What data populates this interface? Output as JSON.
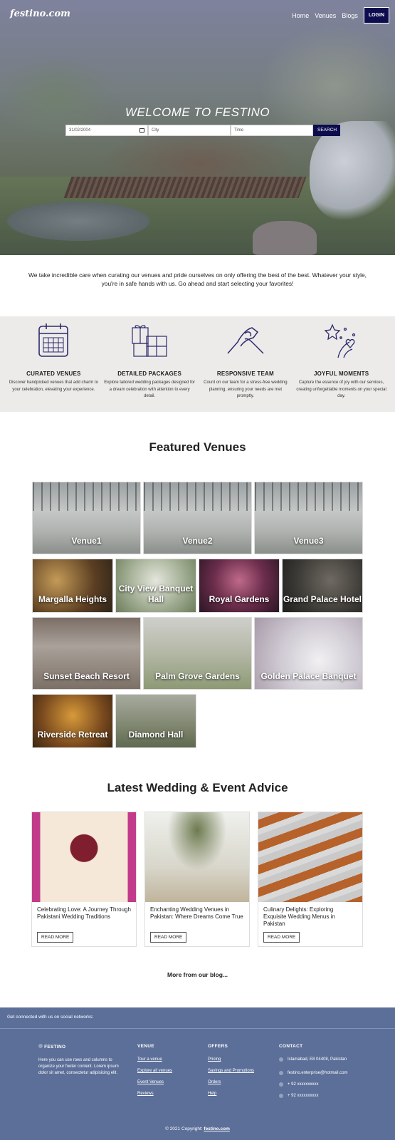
{
  "header": {
    "logo": "festino.com",
    "nav": [
      "Home",
      "Venues",
      "Blogs"
    ],
    "login_label": "LOGIN"
  },
  "hero": {
    "title": "WELCOME TO FESTINO",
    "date_value": "31/02/2004",
    "city_placeholder": "City",
    "time_placeholder": "Time",
    "search_label": "SEARCH"
  },
  "intro": "We take incredible care when curating our venues and pride ourselves on only offering the best of the best. Whatever your style, you're in safe hands with us. Go ahead and start selecting your favorites!",
  "features": [
    {
      "icon": "calendar-icon",
      "title": "CURATED VENUES",
      "text": "Discover handpicked venues that add charm to your celebration, elevating your experience."
    },
    {
      "icon": "gift-packages-icon",
      "title": "DETAILED PACKAGES",
      "text": "Explore tailored wedding packages designed for a dream celebration with attention to every detail."
    },
    {
      "icon": "handshake-icon",
      "title": "RESPONSIVE TEAM",
      "text": "Count on our team for a stress-free wedding planning, ensuring your needs are met promptly."
    },
    {
      "icon": "celebration-icon",
      "title": "JOYFUL MOMENTS",
      "text": "Capture the essence of joy with our services, creating unforgettable moments on your special day."
    }
  ],
  "featured": {
    "heading": "Featured Venues",
    "venues": [
      "Venue1",
      "Venue2",
      "Venue3",
      "Margalla Heights",
      "City View Banquet Hall",
      "Royal Gardens",
      "Grand Palace Hotel",
      "Sunset Beach Resort",
      "Palm Grove Gardens",
      "Golden Palace Banquet",
      "Riverside Retreat",
      "Diamond Hall"
    ]
  },
  "blog": {
    "heading": "Latest Wedding & Event Advice",
    "posts": [
      {
        "title": "Celebrating Love: A Journey Through Pakistani Wedding Traditions",
        "cta": "READ MORE"
      },
      {
        "title": "Enchanting Wedding Venues in Pakistan: Where Dreams Come True",
        "cta": "READ MORE"
      },
      {
        "title": "Culinary Delights: Exploring Exquisite Wedding Menus in Pakistan",
        "cta": "READ MORE"
      }
    ],
    "more": "More from our blog..."
  },
  "footer": {
    "social_text": "Get connected with us on social networks:",
    "festino": {
      "heading": "FESTINO",
      "text": "Here you can use rows and columns to organize your footer content. Lorem ipsum dolor sit amet, consectetur adipisicing elit."
    },
    "venue": {
      "heading": "VENUE",
      "links": [
        "Tour a venue",
        "Explore all venues",
        "Event Venues",
        "Reviews"
      ]
    },
    "offers": {
      "heading": "OFFERS",
      "links": [
        "Pricing",
        "Savings and Promotions",
        "Orders",
        "Help"
      ]
    },
    "contact": {
      "heading": "CONTACT",
      "address": "Islamabad, E8 04408, Pakistan",
      "email": "festino.enterprise@hotmail.com",
      "phone1": "+ 92 xxxxxxxxxx",
      "phone2": "+ 92 xxxxxxxxxx"
    },
    "copyright": "© 2021 Copyright:",
    "copyright_link": "festino.com"
  },
  "colors": {
    "navy": "#0d0c4e",
    "footer": "#5b6f99",
    "feature_bg": "#ecebe9",
    "icon_stroke": "#2d2a6e"
  }
}
